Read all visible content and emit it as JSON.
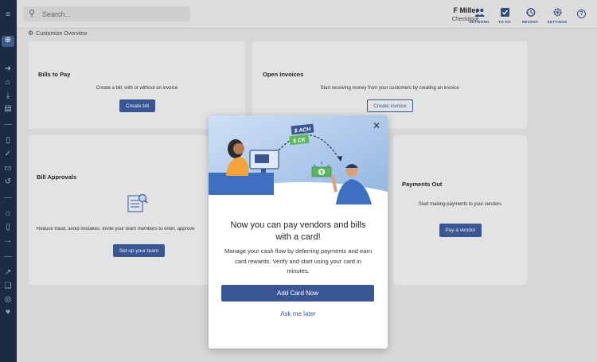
{
  "search": {
    "placeholder": "Search..."
  },
  "user": {
    "name": "F Miller",
    "company": "Checkitout"
  },
  "nav": [
    {
      "label": "NETWORK",
      "icon": "people-icon"
    },
    {
      "label": "TO DO",
      "icon": "checkbox-icon"
    },
    {
      "label": "RECENT",
      "icon": "history-icon"
    },
    {
      "label": "SETTINGS",
      "icon": "gear-icon"
    }
  ],
  "help": {
    "glyph": "?"
  },
  "customize": {
    "label": "Customize Overview"
  },
  "cards": {
    "bills_to_pay": {
      "title": "Bills to Pay",
      "desc": "Create a bill, with or without an invoice",
      "button": "Create bill"
    },
    "open_invoices": {
      "title": "Open Invoices",
      "desc": "Start receiving money from your customers by creating an invoice",
      "button": "Create invoice"
    },
    "bill_approvals": {
      "title": "Bill Approvals",
      "desc": "Reduce fraud, avoid mistakes. Invite your team members to enter, approve",
      "button": "Set up your team"
    },
    "payments_out": {
      "title": "Payments Out",
      "desc": "Start making payments to your vendors",
      "button": "Pay a vendor"
    }
  },
  "modal": {
    "title": "Now you can pay vendors and bills with a card!",
    "body": "Manage your cash flow by deferring payments and earn card rewards. Verify and start using your card in minutes.",
    "cta": "Add Card Now",
    "later": "Ask me later",
    "close": "✕",
    "tags": {
      "ach": "$ ACH",
      "ck": "$ CK"
    }
  },
  "colors": {
    "primary": "#3a5794",
    "rail": "#1d2a44",
    "card_bg": "#e3e3e3"
  }
}
